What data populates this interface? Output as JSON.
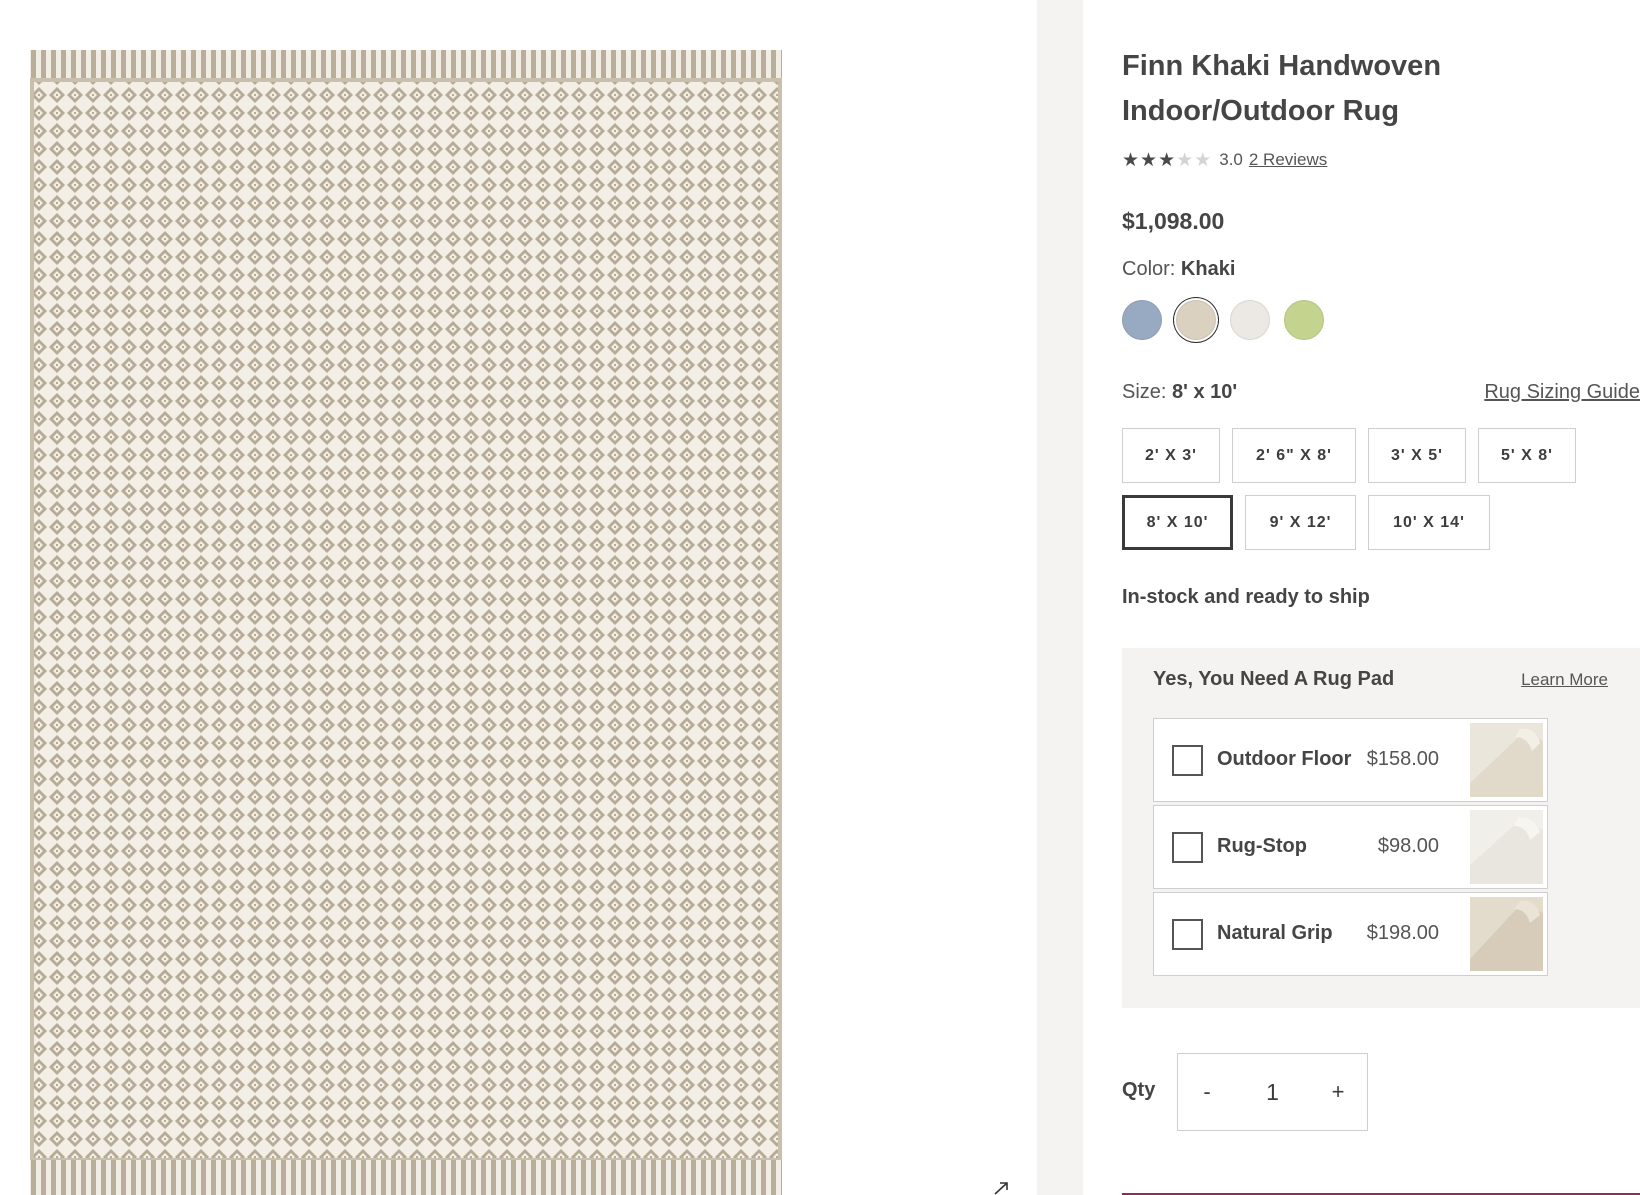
{
  "product": {
    "title": "Finn Khaki Handwoven Indoor/Outdoor Rug",
    "image_alt": "Finn Khaki Handwoven Indoor/Outdoor Rug",
    "rating": {
      "stars_filled": 3,
      "stars_total": 5,
      "value": "3.0",
      "reviews_label": "2 Reviews"
    },
    "price": "$1,098.00"
  },
  "color": {
    "label": "Color:",
    "selected": "Khaki",
    "swatches": [
      {
        "name": "Blue",
        "hex": "#98aac2"
      },
      {
        "name": "Khaki",
        "hex": "#dbd1c1"
      },
      {
        "name": "White",
        "hex": "#ece9e4"
      },
      {
        "name": "Green",
        "hex": "#c4d38e"
      }
    ]
  },
  "size": {
    "label": "Size:",
    "selected": "8' x 10'",
    "guide_label": "Rug Sizing Guide",
    "options": [
      "2' X 3'",
      "2' 6\" X 8'",
      "3' X 5'",
      "5' X 8'",
      "8' X 10'",
      "9' X 12'",
      "10' X 14'"
    ]
  },
  "stock_status": "In-stock and ready to ship",
  "rug_pad": {
    "title": "Yes, You Need A Rug Pad",
    "learn_more": "Learn More",
    "items": [
      {
        "name": "Outdoor Floor",
        "price": "$158.00",
        "checked": false
      },
      {
        "name": "Rug-Stop",
        "price": "$98.00",
        "checked": false
      },
      {
        "name": "Natural Grip",
        "price": "$198.00",
        "checked": false
      }
    ]
  },
  "quantity": {
    "label": "Qty",
    "minus": "-",
    "value": "1",
    "plus": "+"
  },
  "icons": {
    "expand": "expand-arrow-icon",
    "star": "star-icon",
    "checkbox": "checkbox-icon"
  },
  "colors": {
    "rug_base": "#b8ad98",
    "rug_light": "#f3efe6",
    "accent_bottom": "#8a2d5c",
    "panel_gray": "#f4f3f1"
  }
}
